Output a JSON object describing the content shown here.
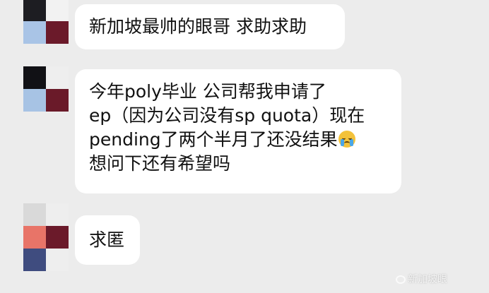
{
  "messages": [
    {
      "avatar_colors": [
        "#1d1d22",
        "#f2f2f2",
        "#a9c4e6",
        "#6b1a2a"
      ],
      "lines": [
        "新加坡最帅的眼哥 求助求助"
      ]
    },
    {
      "avatar_colors": [
        "#111115",
        "#eeeeee",
        "#a7c3e4",
        "#6a1a29"
      ],
      "lines": [
        "今年poly毕业 公司帮我申请了",
        "ep（因为公司没有sp quota）现在",
        "pending了两个半月了还没结果",
        "想问下还有希望吗"
      ],
      "emoji": "crying-face-icon"
    },
    {
      "avatar_colors": [
        "#d9d9d9",
        "#eeeeee",
        "#e87468",
        "#6b1a2a",
        "#3f4c7f"
      ],
      "lines": [
        "求匿"
      ]
    }
  ],
  "watermark": {
    "text": "新加坡眼",
    "icon": "weibo-icon"
  }
}
